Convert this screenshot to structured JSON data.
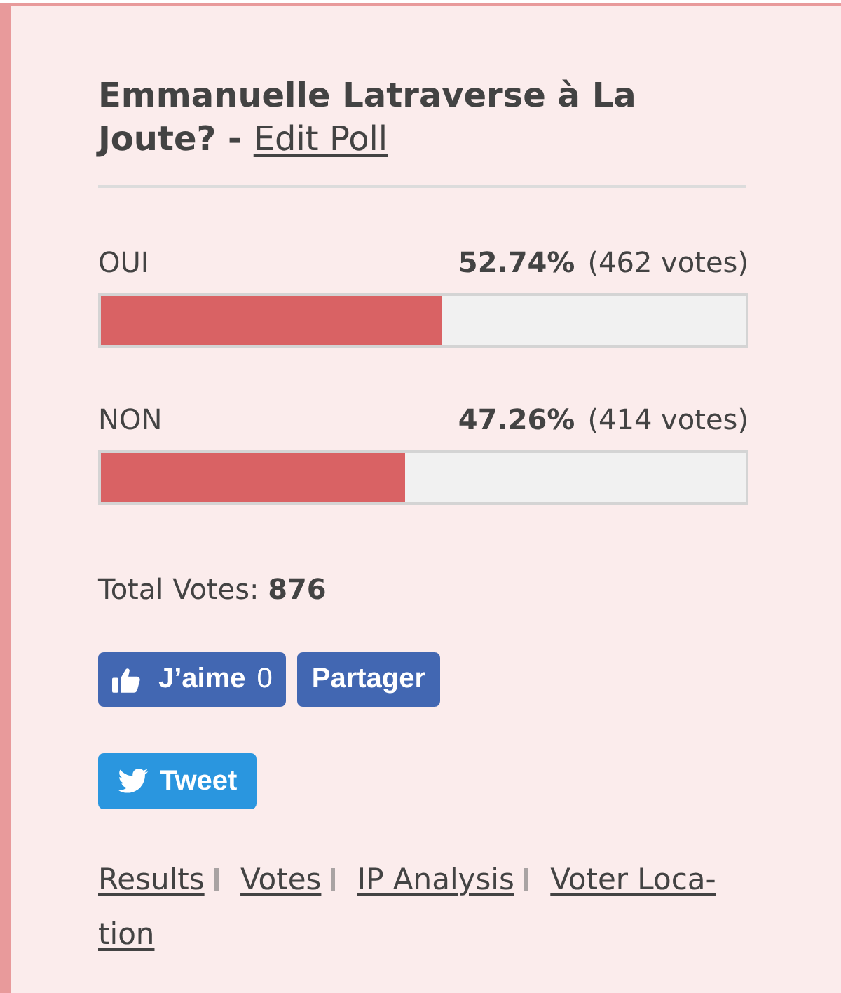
{
  "poll": {
    "title": "Emmanuelle Latraverse à La Joute? -",
    "edit_link": "Edit Poll"
  },
  "options": [
    {
      "label": "OUI",
      "percent": "52.74%",
      "votes": "(462 votes)",
      "level": 0.5274
    },
    {
      "label": "NON",
      "percent": "47.26%",
      "votes": "(414 votes)",
      "level": 0.4726
    }
  ],
  "total": "Total Votes: **876**",
  "facebook": {
    "like_label": "J’aime",
    "like_count": "0",
    "share_label": "Partager"
  },
  "twitter": {
    "tweet_label": "Tweet"
  },
  "links": [
    {
      "lines": [
        "Results"
      ]
    },
    {
      "lines": [
        "Votes"
      ]
    },
    {
      "lines": [
        "IP Analysis"
      ]
    },
    {
      "lines": [
        "Voter Loca-",
        "tion"
      ]
    }
  ]
}
